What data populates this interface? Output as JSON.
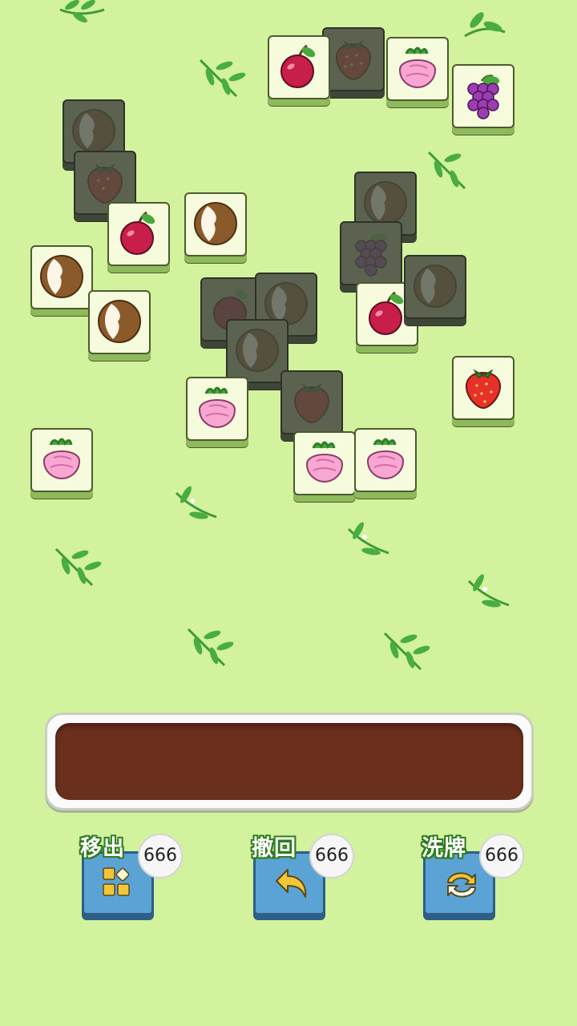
{
  "tools": [
    {
      "label": "移出",
      "count": "666",
      "icon": "move-out-icon"
    },
    {
      "label": "撤回",
      "count": "666",
      "icon": "undo-icon"
    },
    {
      "label": "洗牌",
      "count": "666",
      "icon": "shuffle-icon"
    }
  ],
  "tray": {
    "slots_filled": 0
  },
  "colors": {
    "background": "#d2f29d",
    "tray": "#6b2f1d",
    "tool_button": "#5ba3d4",
    "label_outline": "#2e7d1e"
  },
  "tiles": [
    {
      "fruit": "strawberry",
      "locked": true
    },
    {
      "fruit": "cherry",
      "locked": false
    },
    {
      "fruit": "radish",
      "locked": false
    },
    {
      "fruit": "grape",
      "locked": false
    },
    {
      "fruit": "coconut",
      "locked": true
    },
    {
      "fruit": "strawberry",
      "locked": true
    },
    {
      "fruit": "cherry",
      "locked": false
    },
    {
      "fruit": "coconut",
      "locked": false
    },
    {
      "fruit": "coconut",
      "locked": false
    },
    {
      "fruit": "coconut",
      "locked": false
    },
    {
      "fruit": "coconut",
      "locked": true
    },
    {
      "fruit": "grape",
      "locked": true
    },
    {
      "fruit": "cherry",
      "locked": false
    },
    {
      "fruit": "coconut",
      "locked": true
    },
    {
      "fruit": "cherry",
      "locked": true
    },
    {
      "fruit": "coconut",
      "locked": true
    },
    {
      "fruit": "radish",
      "locked": false
    },
    {
      "fruit": "strawberry",
      "locked": true
    },
    {
      "fruit": "strawberry",
      "locked": false
    },
    {
      "fruit": "radish",
      "locked": false
    },
    {
      "fruit": "radish",
      "locked": false
    },
    {
      "fruit": "radish",
      "locked": false
    }
  ]
}
